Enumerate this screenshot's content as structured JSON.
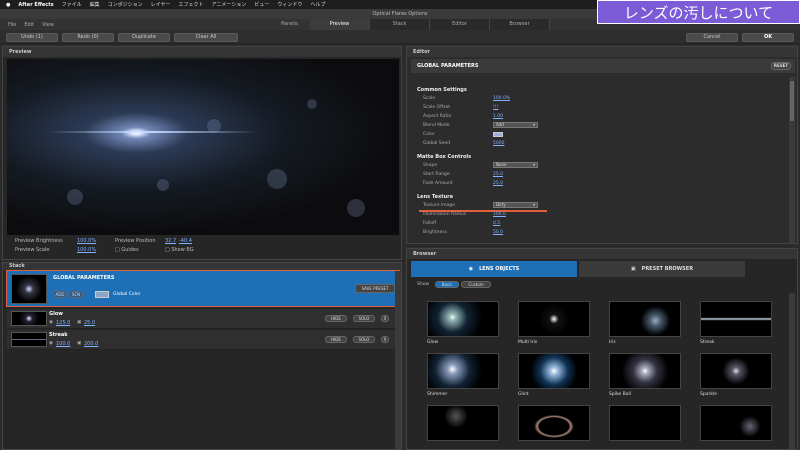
{
  "mac_menu": {
    "app": "After Effects",
    "items": [
      "ファイル",
      "編集",
      "コンポジション",
      "レイヤー",
      "エフェクト",
      "アニメーション",
      "ビュー",
      "ウィンドウ",
      "ヘルプ"
    ]
  },
  "overlay_title": "レンズの汚しについて",
  "window_title": "Optical Flares Options",
  "menu": [
    "File",
    "Edit",
    "View"
  ],
  "tabs": [
    "Panels:",
    "Preview",
    "Stack",
    "Editor",
    "Browser"
  ],
  "toolbar": {
    "undo": "Undo (1)",
    "redo": "Redo (0)",
    "duplicate": "Duplicate",
    "clear": "Clear All",
    "cancel": "Cancel",
    "ok": "OK"
  },
  "preview": {
    "title": "Preview",
    "brightness_label": "Preview Brightness",
    "brightness_value": "100.0%",
    "scale_label": "Preview Scale",
    "scale_value": "100.0%",
    "position_label": "Preview Position",
    "position_x": "32.7",
    "position_y": "-40.4",
    "guides_label": "Guides",
    "showbg_label": "Show BG"
  },
  "stack": {
    "title": "Stack",
    "global": {
      "name": "GLOBAL PARAMETERS",
      "add": "ADD",
      "scn": "SCN",
      "color_label": "Global Color",
      "save": "SAVE PRESET"
    },
    "layers": [
      {
        "name": "Glow",
        "v1": "125.0",
        "v2": "25.0",
        "hide": "HIDE",
        "solo": "SOLO",
        "x": "X"
      },
      {
        "name": "Streak",
        "v1": "100.0",
        "v2": "200.0",
        "hide": "HIDE",
        "solo": "SOLO",
        "x": "X"
      }
    ]
  },
  "editor": {
    "title": "Editor",
    "header": "GLOBAL PARAMETERS",
    "reset": "RESET",
    "sections": [
      {
        "title": "Common Settings",
        "params": [
          {
            "label": "Scale",
            "value": "100.0%"
          },
          {
            "label": "Scale Offset",
            "value": "!!!"
          },
          {
            "label": "Aspect Ratio",
            "value": "1.00"
          },
          {
            "label": "Blend Mode",
            "value": "Add",
            "dropdown": true
          },
          {
            "label": "Color",
            "value": "",
            "swatch": true
          },
          {
            "label": "Global Seed",
            "value": "5000"
          }
        ]
      },
      {
        "title": "Matte Box Controls",
        "params": [
          {
            "label": "Shape",
            "value": "None",
            "dropdown": true
          },
          {
            "label": "Start Range",
            "value": "25.0"
          },
          {
            "label": "Fade Amount",
            "value": "25.0"
          }
        ]
      },
      {
        "title": "Lens Texture",
        "params": [
          {
            "label": "Texture Image",
            "value": "Dirty",
            "dropdown": true
          },
          {
            "label": "Illumination Radius",
            "value": "100.0"
          },
          {
            "label": "Falloff",
            "value": "0.5"
          },
          {
            "label": "Brightness",
            "value": "50.0"
          }
        ]
      }
    ]
  },
  "browser": {
    "title": "Browser",
    "tab_lens": "LENS OBJECTS",
    "tab_preset": "PRESET BROWSER",
    "show_label": "Show",
    "basic": "Basic",
    "custom": "Custom",
    "items": [
      "Glow",
      "Multi Iris",
      "Iris",
      "Streak",
      "Shimmer",
      "Glint",
      "Spike Ball",
      "Sparkle",
      "",
      "",
      "",
      ""
    ]
  }
}
